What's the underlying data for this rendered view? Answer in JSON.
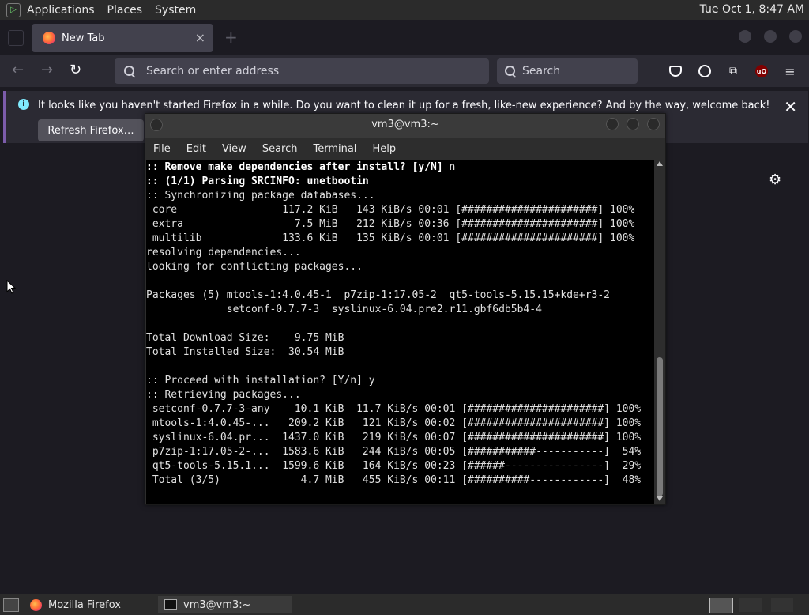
{
  "top_panel": {
    "menus": [
      "Applications",
      "Places",
      "System"
    ],
    "clock": "Tue Oct  1,  8:47 AM"
  },
  "firefox": {
    "tab": {
      "title": "New Tab",
      "close": "×"
    },
    "urlbar_placeholder": "Search or enter address",
    "searchbar_placeholder": "Search",
    "notification": {
      "message": "It looks like you haven't started Firefox in a while. Do you want to clean it up for a fresh, like-new experience? And by the way, welcome back!",
      "button": "Refresh Firefox…",
      "close": "✕"
    },
    "ublock_label": "uO"
  },
  "terminal": {
    "title": "vm3@vm3:~",
    "menus": [
      "File",
      "Edit",
      "View",
      "Search",
      "Terminal",
      "Help"
    ],
    "lines": [
      {
        "text": ":: Remove make dependencies after install? [y/N] ",
        "bold": true,
        "suffix": "n"
      },
      {
        "text": ":: (1/1) Parsing SRCINFO: unetbootin",
        "bold": true
      },
      {
        "text": ":: Synchronizing package databases..."
      },
      {
        "text": " core                 117.2 KiB   143 KiB/s 00:01 [######################] 100%"
      },
      {
        "text": " extra                  7.5 MiB   212 KiB/s 00:36 [######################] 100%"
      },
      {
        "text": " multilib             133.6 KiB   135 KiB/s 00:01 [######################] 100%"
      },
      {
        "text": "resolving dependencies..."
      },
      {
        "text": "looking for conflicting packages..."
      },
      {
        "text": ""
      },
      {
        "text": "Packages (5) mtools-1:4.0.45-1  p7zip-1:17.05-2  qt5-tools-5.15.15+kde+r3-2"
      },
      {
        "text": "             setconf-0.7.7-3  syslinux-6.04.pre2.r11.gbf6db5b4-4"
      },
      {
        "text": ""
      },
      {
        "text": "Total Download Size:    9.75 MiB"
      },
      {
        "text": "Total Installed Size:  30.54 MiB"
      },
      {
        "text": ""
      },
      {
        "text": ":: Proceed with installation? [Y/n] y"
      },
      {
        "text": ":: Retrieving packages..."
      },
      {
        "text": " setconf-0.7.7-3-any    10.1 KiB  11.7 KiB/s 00:01 [######################] 100%"
      },
      {
        "text": " mtools-1:4.0.45-...   209.2 KiB   121 KiB/s 00:02 [######################] 100%"
      },
      {
        "text": " syslinux-6.04.pr...  1437.0 KiB   219 KiB/s 00:07 [######################] 100%"
      },
      {
        "text": " p7zip-1:17.05-2-...  1583.6 KiB   244 KiB/s 00:05 [###########-----------]  54%"
      },
      {
        "text": " qt5-tools-5.15.1...  1599.6 KiB   164 KiB/s 00:23 [######----------------]  29%"
      },
      {
        "text": " Total (3/5)             4.7 MiB   455 KiB/s 00:11 [##########------------]  48%"
      }
    ]
  },
  "taskbar": {
    "items": [
      "Mozilla Firefox",
      "vm3@vm3:~"
    ]
  }
}
